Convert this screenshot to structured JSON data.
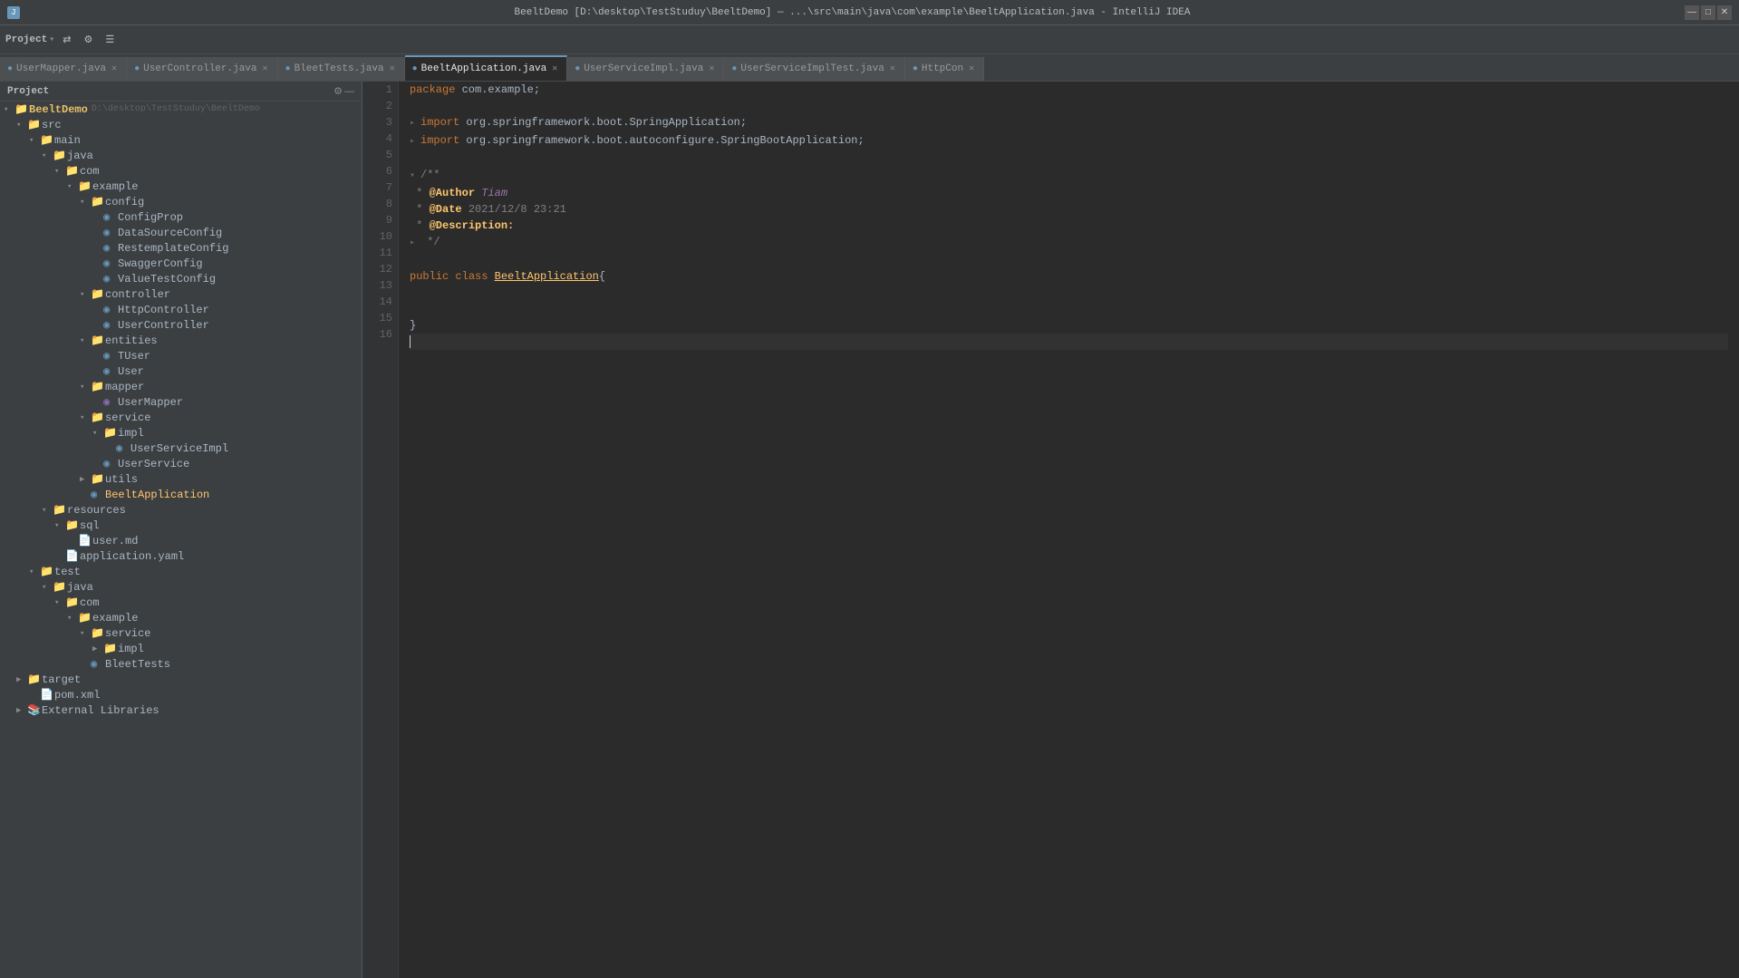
{
  "titleBar": {
    "icon": "J",
    "text": "BeeltDemo [D:\\desktop\\TestStuduy\\BeeltDemo] — ...\\src\\main\\java\\com\\example\\BeeltApplication.java - IntelliJ IDEA",
    "minimize": "—",
    "maximize": "□",
    "close": "✕"
  },
  "toolbar": {
    "project_label": "Project",
    "btn1": "⚙",
    "btn2": "⇄",
    "btn3": "⚙",
    "btn4": "☰"
  },
  "tabs": [
    {
      "label": "UserMapper.java",
      "active": false,
      "color": "blue"
    },
    {
      "label": "UserController.java",
      "active": false,
      "color": "blue"
    },
    {
      "label": "BleetTests.java",
      "active": false,
      "color": "blue"
    },
    {
      "label": "BeeltApplication.java",
      "active": true,
      "color": "blue"
    },
    {
      "label": "UserServiceImpl.java",
      "active": false,
      "color": "blue"
    },
    {
      "label": "UserServiceImplTest.java",
      "active": false,
      "color": "blue"
    },
    {
      "label": "HttpCon",
      "active": false,
      "color": "blue"
    }
  ],
  "sidebar": {
    "title": "Project",
    "tree": [
      {
        "label": "BeeltDemo",
        "path": "D:\\desktop\\TestStuduy\\BeeltDemo",
        "level": 0,
        "type": "root",
        "expanded": true
      },
      {
        "label": "src",
        "level": 1,
        "type": "folder",
        "expanded": true
      },
      {
        "label": "main",
        "level": 2,
        "type": "folder",
        "expanded": true
      },
      {
        "label": "java",
        "level": 3,
        "type": "folder",
        "expanded": true
      },
      {
        "label": "com",
        "level": 4,
        "type": "folder",
        "expanded": true
      },
      {
        "label": "example",
        "level": 5,
        "type": "folder",
        "expanded": true
      },
      {
        "label": "config",
        "level": 6,
        "type": "folder",
        "expanded": true
      },
      {
        "label": "ConfigProp",
        "level": 7,
        "type": "class",
        "fileColor": "blue"
      },
      {
        "label": "DataSourceConfig",
        "level": 7,
        "type": "class",
        "fileColor": "blue"
      },
      {
        "label": "RestemplateConfig",
        "level": 7,
        "type": "class",
        "fileColor": "blue"
      },
      {
        "label": "SwaggerConfig",
        "level": 7,
        "type": "class",
        "fileColor": "blue"
      },
      {
        "label": "ValueTestConfig",
        "level": 7,
        "type": "class",
        "fileColor": "blue"
      },
      {
        "label": "controller",
        "level": 6,
        "type": "folder",
        "expanded": true
      },
      {
        "label": "HttpController",
        "level": 7,
        "type": "class",
        "fileColor": "blue"
      },
      {
        "label": "UserController",
        "level": 7,
        "type": "class",
        "fileColor": "blue"
      },
      {
        "label": "entities",
        "level": 6,
        "type": "folder",
        "expanded": true
      },
      {
        "label": "TUser",
        "level": 7,
        "type": "class",
        "fileColor": "blue"
      },
      {
        "label": "User",
        "level": 7,
        "type": "class",
        "fileColor": "blue"
      },
      {
        "label": "mapper",
        "level": 6,
        "type": "folder",
        "expanded": true
      },
      {
        "label": "UserMapper",
        "level": 7,
        "type": "class",
        "fileColor": "mapper"
      },
      {
        "label": "service",
        "level": 6,
        "type": "folder",
        "expanded": true
      },
      {
        "label": "impl",
        "level": 7,
        "type": "folder",
        "expanded": true
      },
      {
        "label": "UserServiceImpl",
        "level": 8,
        "type": "class",
        "fileColor": "blue"
      },
      {
        "label": "UserService",
        "level": 7,
        "type": "class",
        "fileColor": "blue"
      },
      {
        "label": "utils",
        "level": 6,
        "type": "folder",
        "expanded": false
      },
      {
        "label": "BeeltApplication",
        "level": 6,
        "type": "class",
        "fileColor": "blue"
      },
      {
        "label": "resources",
        "level": 3,
        "type": "folder",
        "expanded": true
      },
      {
        "label": "sql",
        "level": 4,
        "type": "folder",
        "expanded": true
      },
      {
        "label": "user.md",
        "level": 5,
        "type": "file",
        "fileColor": "yellow"
      },
      {
        "label": "application.yaml",
        "level": 4,
        "type": "file",
        "fileColor": "green"
      },
      {
        "label": "test",
        "level": 2,
        "type": "folder",
        "expanded": true
      },
      {
        "label": "java",
        "level": 3,
        "type": "folder",
        "expanded": true
      },
      {
        "label": "com",
        "level": 4,
        "type": "folder",
        "expanded": true
      },
      {
        "label": "example",
        "level": 5,
        "type": "folder",
        "expanded": true
      },
      {
        "label": "service",
        "level": 6,
        "type": "folder",
        "expanded": true
      },
      {
        "label": "impl",
        "level": 7,
        "type": "folder",
        "expanded": false
      },
      {
        "label": "BleetTests",
        "level": 6,
        "type": "class",
        "fileColor": "blue"
      },
      {
        "label": "target",
        "level": 1,
        "type": "folder",
        "expanded": false
      },
      {
        "label": "pom.xml",
        "level": 2,
        "type": "file",
        "fileColor": "orange"
      },
      {
        "label": "External Libraries",
        "level": 1,
        "type": "lib",
        "expanded": false
      }
    ]
  },
  "editor": {
    "filename": "BeeltApplication.java",
    "lines": [
      {
        "num": 1,
        "tokens": [
          {
            "t": "kw",
            "v": "package "
          },
          {
            "t": "plain",
            "v": "com.example;"
          }
        ]
      },
      {
        "num": 2,
        "tokens": []
      },
      {
        "num": 3,
        "tokens": [
          {
            "t": "fold",
            "v": "▸"
          },
          {
            "t": "kw",
            "v": "import "
          },
          {
            "t": "plain",
            "v": "org.springframework.boot.SpringApplication;"
          }
        ]
      },
      {
        "num": 4,
        "tokens": [
          {
            "t": "fold",
            "v": "▸"
          },
          {
            "t": "kw",
            "v": "import "
          },
          {
            "t": "plain",
            "v": "org.springframework.boot.autoconfigure.SpringBootApplication;"
          }
        ]
      },
      {
        "num": 5,
        "tokens": []
      },
      {
        "num": 6,
        "tokens": [
          {
            "t": "fold",
            "v": "▾"
          },
          {
            "t": "comment",
            "v": "/**"
          }
        ]
      },
      {
        "num": 7,
        "tokens": [
          {
            "t": "comment",
            "v": " * "
          },
          {
            "t": "at-tag",
            "v": "@Author"
          },
          {
            "t": "at-val",
            "v": " Tiam"
          }
        ]
      },
      {
        "num": 8,
        "tokens": [
          {
            "t": "comment",
            "v": " * "
          },
          {
            "t": "at-tag",
            "v": "@Date"
          },
          {
            "t": "comment",
            "v": " 2021/12/8 23:21"
          }
        ]
      },
      {
        "num": 9,
        "tokens": [
          {
            "t": "comment",
            "v": " * "
          },
          {
            "t": "at-tag",
            "v": "@Description:"
          }
        ]
      },
      {
        "num": 10,
        "tokens": [
          {
            "t": "fold",
            "v": "▸"
          },
          {
            "t": "comment",
            "v": " */"
          }
        ]
      },
      {
        "num": 11,
        "tokens": []
      },
      {
        "num": 12,
        "tokens": [
          {
            "t": "kw",
            "v": "public "
          },
          {
            "t": "kw",
            "v": "class "
          },
          {
            "t": "class-name",
            "v": "BeeltApplication"
          },
          {
            "t": "plain",
            "v": "{"
          }
        ]
      },
      {
        "num": 13,
        "tokens": []
      },
      {
        "num": 14,
        "tokens": []
      },
      {
        "num": 15,
        "tokens": [
          {
            "t": "plain",
            "v": "}"
          }
        ]
      },
      {
        "num": 16,
        "tokens": [
          {
            "t": "cursor",
            "v": ""
          }
        ]
      }
    ]
  }
}
